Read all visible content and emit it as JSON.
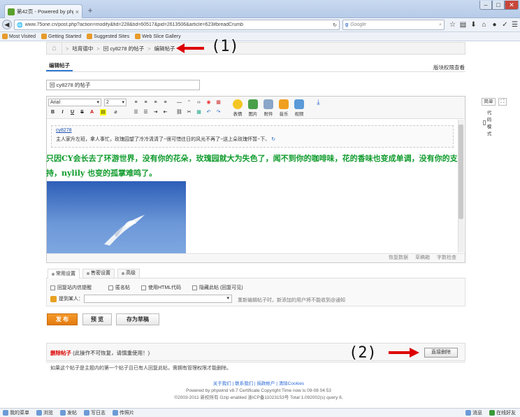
{
  "browser": {
    "tab_title": "第42页 - Powered by php...",
    "tab_close": "×",
    "new_tab": "+",
    "window_buttons": {
      "minimize": "–",
      "maximize": "□",
      "close": "✕"
    },
    "url": "www.75one.cn/post.php?action=modify&fid=228&tid=60517&pid=2613506&article=623#breadCrumb",
    "search_placeholder": "Google",
    "bookmarks": [
      "Most Visited",
      "Getting Started",
      "Suggested Sites",
      "Web Slice Gallery"
    ]
  },
  "page": {
    "breadcrumb": [
      "咕育德中",
      "回 cy8278 的帖子",
      "编辑帖子"
    ],
    "breadcrumb_sep": ">",
    "callout1": "(1)",
    "callout2": "(2)",
    "edit_tab": "编辑帖子",
    "perm_link": "版块权限查看",
    "subject": "回 cy8278 的帖子",
    "editor": {
      "font": "Arial",
      "size": "2",
      "big_buttons": [
        "表情",
        "图片",
        "附件",
        "音乐",
        "视频"
      ],
      "source_button": "简单",
      "fullscreen": "⛶",
      "code_mode": "代码模式",
      "quote_author": "cy8278",
      "quote_text": "主人家升左班，拿人事忙，玫瑰园望了冷冷清清了~很可惜往日的风光不再了~送上朵玫瑰怀暂~下、",
      "body": "只因CY会长去了环游世界，没有你的花朵，玫瑰园就大为失色了，闻不到你的咖啡味，花的香味也变成单调，没有你的支持，nylily 也变的孤掌难鸣了。",
      "status": [
        "恢复数据",
        "草稿箱",
        "字数检查"
      ]
    },
    "setting_tabs": [
      "常用设置",
      "售密设置",
      "高级"
    ],
    "options": [
      "回复站内信提醒",
      "匿名帖",
      "使用HTML代码",
      "隐藏此帖 (回复可见)"
    ],
    "mention_label": "提到某人：",
    "mention_tip": "重新编辑帖子时，新添加的用户将不能收到@通知",
    "buttons": {
      "publish": "发 布",
      "preview": "预 览",
      "draft": "存为草稿"
    },
    "delete": {
      "title": "删除帖子",
      "warn": "(此操作不可恢复，请慎重使用！)",
      "button": "直接删除",
      "note": "如果这个帖子是主题内的第一个帖子且已有人回复此帖，需拥有管理权限才能删除。"
    },
    "footer": {
      "links": "关于我们 | 联系我们 | 捐款帐户 | 清除Cookies",
      "line2": "Powered by phpwind v8.7 Certificate Copyright Time now is 09-08 04:53",
      "line3": "©2003-2011 新校所有 Gzip enabled 浙ICP备11023153号 Total 1.092002(s) query 8,"
    }
  },
  "statusbar": {
    "left": [
      "我的菜单",
      "浏览",
      "发帖",
      "写日志",
      "传照片"
    ],
    "right": [
      "消息",
      "在线好友"
    ]
  }
}
